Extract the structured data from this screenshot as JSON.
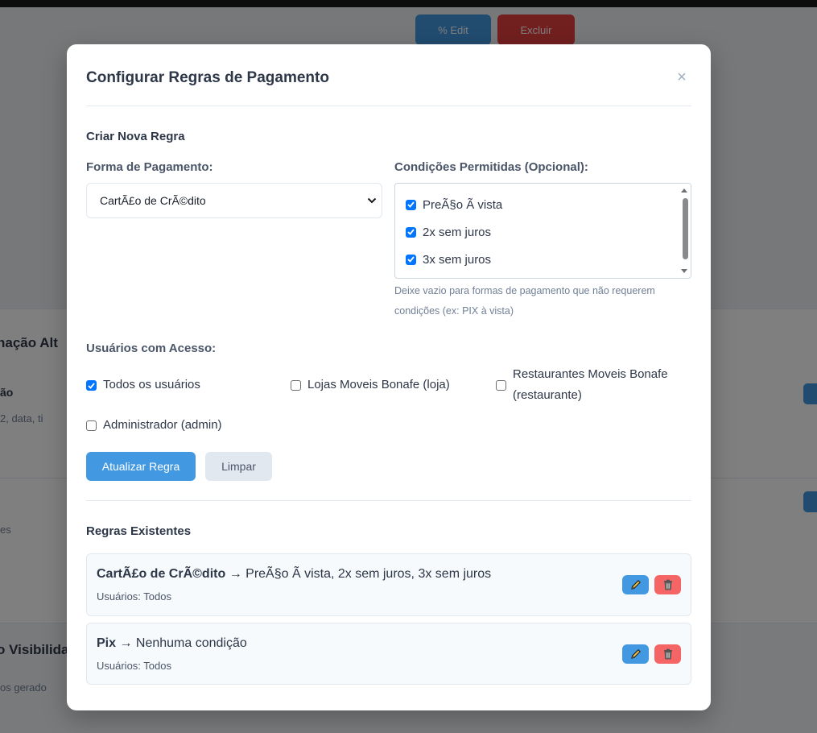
{
  "background": {
    "top_buttons": [
      "% Edit",
      "Excluir"
    ],
    "fragments": [
      "nação Alt",
      "ão",
      "2, data, ti",
      "es",
      "o Visibilida",
      "os gerado"
    ]
  },
  "modal": {
    "title": "Configurar Regras de Pagamento",
    "close_label": "×",
    "new_rule_title": "Criar Nova Regra",
    "payment_label": "Forma de Pagamento:",
    "payment_selected": "CartÃ£o de CrÃ©dito",
    "conditions_label": "Condições Permitidas (Opcional):",
    "conditions": [
      {
        "label": "PreÃ§o Ã  vista",
        "checked": true
      },
      {
        "label": "2x sem juros",
        "checked": true
      },
      {
        "label": "3x sem juros",
        "checked": true
      }
    ],
    "conditions_hint": "Deixe vazio para formas de pagamento que não requerem condições (ex: PIX à vista)",
    "users_label": "Usuários com Acesso:",
    "users": [
      {
        "label": "Todos os usuários",
        "checked": true
      },
      {
        "label": "Lojas Moveis Bonafe (loja)",
        "checked": false
      },
      {
        "label": "Restaurantes Moveis Bonafe (restaurante)",
        "checked": false
      },
      {
        "label": "Administrador (admin)",
        "checked": false
      }
    ],
    "update_button": "Atualizar Regra",
    "clear_button": "Limpar",
    "existing_title": "Regras Existentes",
    "rules": [
      {
        "payment": "CartÃ£o de CrÃ©dito",
        "arrow": " → ",
        "conditions": "PreÃ§o Ã  vista, 2x sem juros, 3x sem juros",
        "users": "Usuários: Todos"
      },
      {
        "payment": "Pix",
        "arrow": " → ",
        "conditions": "Nenhuma condição",
        "users": "Usuários: Todos"
      }
    ]
  },
  "icons": {
    "edit": "pencil-icon",
    "delete": "trash-icon",
    "close": "close-icon"
  },
  "colors": {
    "primary": "#4299e1",
    "danger": "#f56565",
    "checkbox": "#0075ff"
  }
}
